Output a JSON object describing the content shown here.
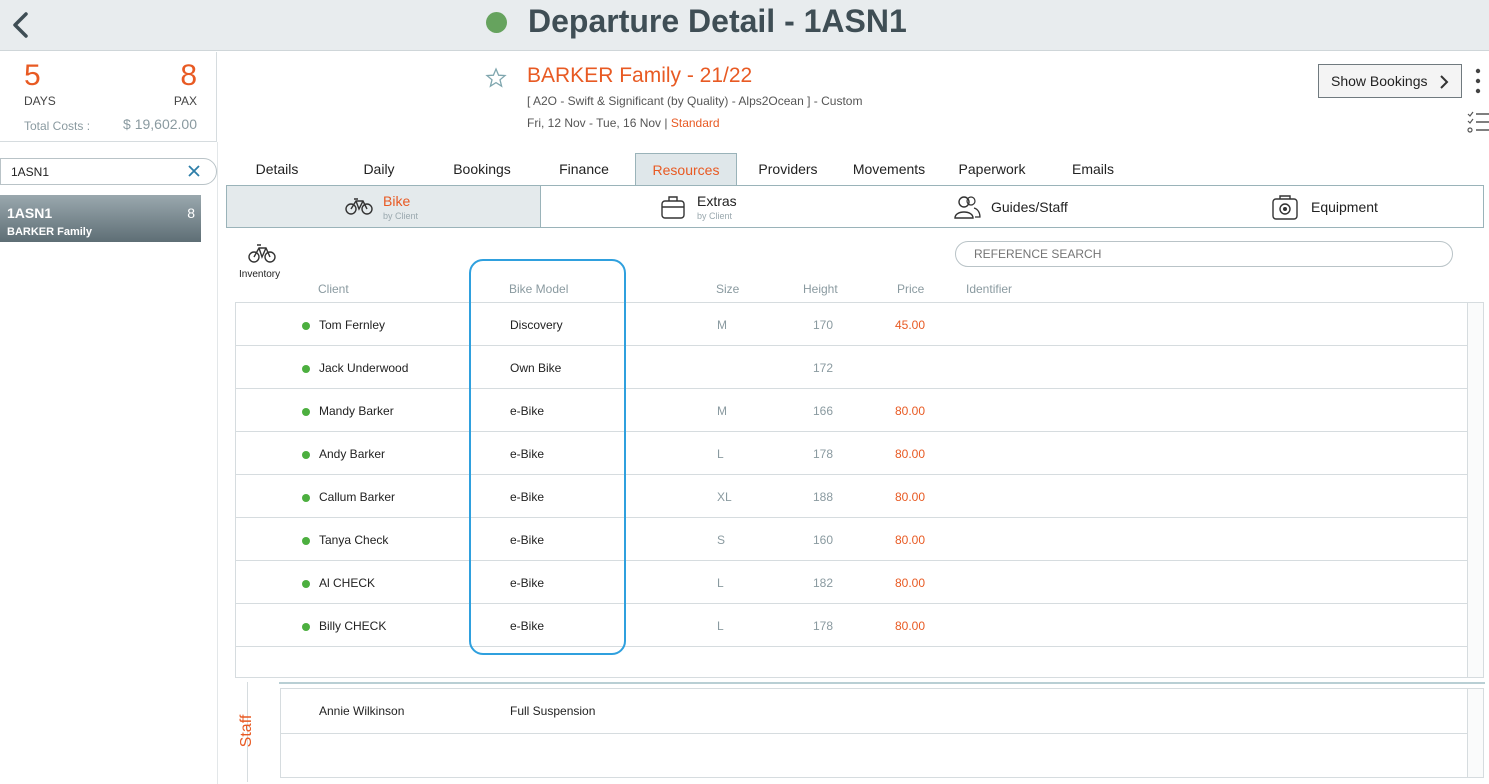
{
  "header": {
    "title": "Departure Detail - 1ASN1",
    "status_color": "#66a35e"
  },
  "summary": {
    "days": "5",
    "days_label": "DAYS",
    "pax": "8",
    "pax_label": "PAX",
    "total_costs_label": "Total Costs :",
    "total_costs_value": "$ 19,602.00"
  },
  "sidebar": {
    "search_value": "1ASN1",
    "departures": [
      {
        "code": "1ASN1",
        "pax": "8",
        "name": "BARKER Family"
      }
    ]
  },
  "booking": {
    "family_title": "BARKER Family - 21/22",
    "tour_line": "[ A2O - Swift & Significant (by Quality) - Alps2Ocean ] - Custom",
    "dates": "Fri, 12 Nov  - Tue, 16 Nov  |",
    "standard": "Standard",
    "show_bookings_label": "Show Bookings"
  },
  "tabs": [
    "Details",
    "Daily",
    "Bookings",
    "Finance",
    "Resources",
    "Providers",
    "Movements",
    "Paperwork",
    "Emails"
  ],
  "active_tab": "Resources",
  "subtabs": [
    {
      "label": "Bike",
      "sub": "by Client",
      "icon": "bike-icon"
    },
    {
      "label": "Extras",
      "sub": "by Client",
      "icon": "bag-icon"
    },
    {
      "label": "Guides/Staff",
      "sub": "",
      "icon": "staff-icon"
    },
    {
      "label": "Equipment",
      "sub": "",
      "icon": "equipment-icon"
    }
  ],
  "inventory_label": "Inventory",
  "reference_search_placeholder": "REFERENCE SEARCH",
  "columns": {
    "client": "Client",
    "bike_model": "Bike Model",
    "size": "Size",
    "height": "Height",
    "price": "Price",
    "identifier": "Identifier"
  },
  "rows": [
    {
      "client": "Tom Fernley",
      "model": "Discovery",
      "size": "M",
      "height": "170",
      "price": "45.00"
    },
    {
      "client": "Jack Underwood",
      "model": "Own Bike",
      "size": "",
      "height": "172",
      "price": ""
    },
    {
      "client": "Mandy Barker",
      "model": "e-Bike",
      "size": "M",
      "height": "166",
      "price": "80.00"
    },
    {
      "client": "Andy Barker",
      "model": "e-Bike",
      "size": "L",
      "height": "178",
      "price": "80.00"
    },
    {
      "client": "Callum Barker",
      "model": "e-Bike",
      "size": "XL",
      "height": "188",
      "price": "80.00"
    },
    {
      "client": "Tanya Check",
      "model": "e-Bike",
      "size": "S",
      "height": "160",
      "price": "80.00"
    },
    {
      "client": "Al CHECK",
      "model": "e-Bike",
      "size": "L",
      "height": "182",
      "price": "80.00"
    },
    {
      "client": "Billy CHECK",
      "model": "e-Bike",
      "size": "L",
      "height": "178",
      "price": "80.00"
    }
  ],
  "staff": {
    "label": "Staff",
    "rows": [
      {
        "client": "Annie Wilkinson",
        "model": "Full Suspension"
      }
    ]
  },
  "colors": {
    "accent": "#e85a23",
    "highlight": "#2fa0de",
    "status_dot": "#4caf3f"
  }
}
